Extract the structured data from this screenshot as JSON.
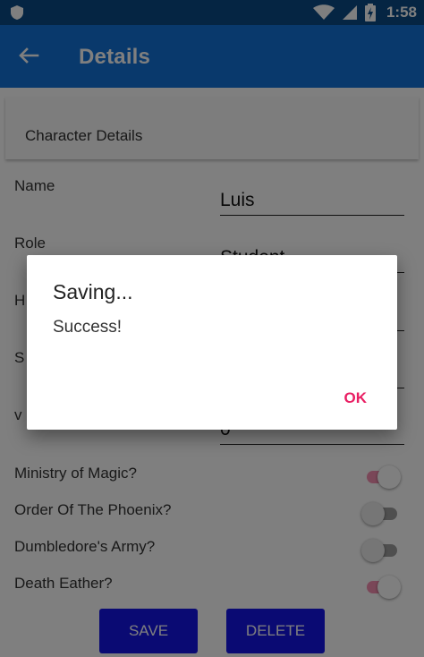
{
  "status_bar": {
    "time": "1:58",
    "left_icon": "shield-icon",
    "icons": [
      "wifi-icon",
      "cell-signal-icon",
      "battery-charging-icon"
    ]
  },
  "app_bar": {
    "back_icon": "arrow-back-icon",
    "title": "Details"
  },
  "card": {
    "title": "Character Details"
  },
  "fields": [
    {
      "label": "Name",
      "value": "Luis"
    },
    {
      "label": "Role",
      "value": "Student"
    },
    {
      "label": "H",
      "value": ""
    },
    {
      "label": "S",
      "value": ""
    },
    {
      "label": "v",
      "value": "0"
    }
  ],
  "switches": [
    {
      "label": "Ministry of Magic?",
      "on": true
    },
    {
      "label": "Order Of The Phoenix?",
      "on": false
    },
    {
      "label": "Dumbledore's Army?",
      "on": false
    },
    {
      "label": "Death Eather?",
      "on": true
    }
  ],
  "buttons": {
    "save": "SAVE",
    "delete": "DELETE"
  },
  "dialog": {
    "title": "Saving...",
    "message": "Success!",
    "ok": "OK"
  },
  "colors": {
    "status_bar": "#0a4a86",
    "app_bar": "#1373d8",
    "button": "#1515e6",
    "accent": "#e91e63"
  }
}
